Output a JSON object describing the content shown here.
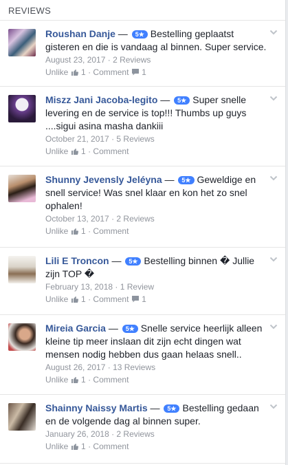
{
  "header": {
    "title": "REVIEWS"
  },
  "colors": {
    "link": "#365899",
    "badge": "#4080ff",
    "muted": "#90949c"
  },
  "icons": {
    "like": "thumbs-up-icon",
    "comment": "comment-bubble-icon",
    "menu": "chevron-down-icon"
  },
  "reviews": [
    {
      "author": "Roushan Danje",
      "rating": "5★",
      "text": "Bestelling geplaatst gisteren en die is vandaag al binnen. Super service.",
      "date": "August 23, 2017",
      "review_count": "2 Reviews",
      "unlike": "Unlike",
      "likes": "1",
      "comment": "Comment",
      "comments": "1"
    },
    {
      "author": "Miszz Jani Jacoba-legito",
      "rating": "5★",
      "text": "Super snelle levering en de service is top!!! Thumbs up guys ....sigui asina masha dankiii",
      "date": "October 21, 2017",
      "review_count": "5 Reviews",
      "unlike": "Unlike",
      "likes": "1",
      "comment": "Comment",
      "comments": ""
    },
    {
      "author": "Shunny Jevensly Jeléyna",
      "rating": "5★",
      "text": "Geweldige en snell service! Was snel klaar en kon het zo snel ophalen!",
      "date": "October 13, 2017",
      "review_count": "2 Reviews",
      "unlike": "Unlike",
      "likes": "1",
      "comment": "Comment",
      "comments": ""
    },
    {
      "author": "Lili E Troncon",
      "rating": "5★",
      "text": "Bestelling binnen � Jullie zijn TOP �",
      "date": "February 13, 2018",
      "review_count": "1 Review",
      "unlike": "Unlike",
      "likes": "1",
      "comment": "Comment",
      "comments": "1"
    },
    {
      "author": "Mireia Garcia",
      "rating": "5★",
      "text": "Snelle service heerlijk alleen kleine tip meer inslaan dit zijn echt dingen wat mensen nodig hebben dus gaan helaas snell..",
      "date": "August 26, 2017",
      "review_count": "13 Reviews",
      "unlike": "Unlike",
      "likes": "1",
      "comment": "Comment",
      "comments": ""
    },
    {
      "author": "Shainny Naissy Martis",
      "rating": "5★",
      "text": "Bestelling gedaan en de volgende dag al binnen super.",
      "date": "January 26, 2018",
      "review_count": "2 Reviews",
      "unlike": "Unlike",
      "likes": "1",
      "comment": "Comment",
      "comments": ""
    }
  ]
}
